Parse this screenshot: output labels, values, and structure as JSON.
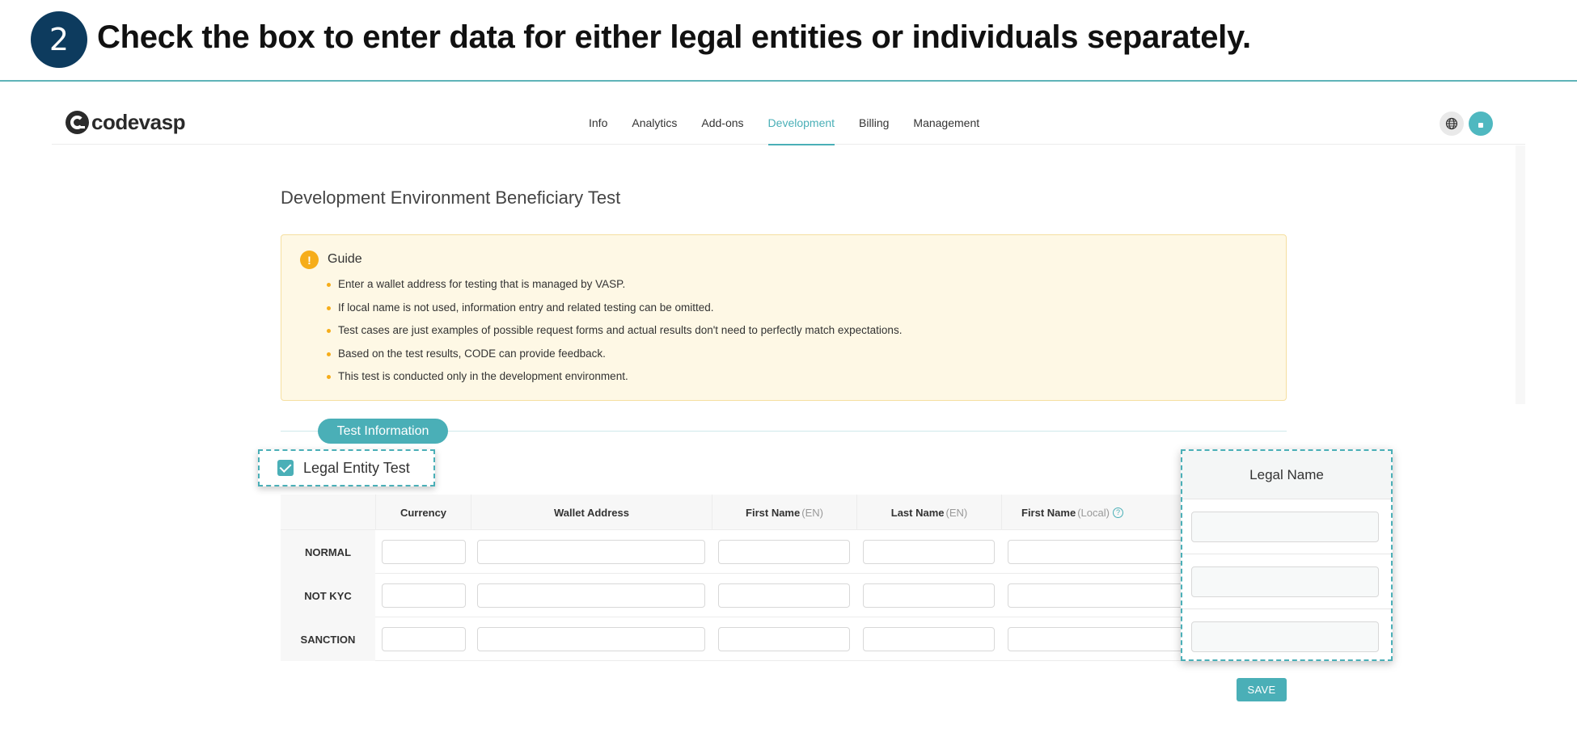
{
  "instruction": {
    "step": "2",
    "text": "Check the box to enter data for either legal entities or individuals separately."
  },
  "header": {
    "logo_text": "codevasp",
    "nav": [
      {
        "label": "Info",
        "active": false
      },
      {
        "label": "Analytics",
        "active": false
      },
      {
        "label": "Add-ons",
        "active": false
      },
      {
        "label": "Development",
        "active": true
      },
      {
        "label": "Billing",
        "active": false
      },
      {
        "label": "Management",
        "active": false
      }
    ],
    "icons": [
      "globe-icon",
      "avatar"
    ]
  },
  "page": {
    "title": "Development Environment Beneficiary Test"
  },
  "guide": {
    "title": "Guide",
    "icon": "!",
    "items": [
      "Enter a wallet address for testing that is managed by VASP.",
      "If local name is not used, information entry and related testing can be omitted.",
      "Test cases are just examples of possible request forms and actual results don't need to perfectly match expectations.",
      "Based on the test results, CODE can provide feedback.",
      "This test is conducted only in the development environment."
    ]
  },
  "section": {
    "label": "Test Information"
  },
  "checkbox": {
    "label": "Legal Entity Test",
    "checked": true
  },
  "table": {
    "columns": [
      {
        "label": "Currency",
        "sub": ""
      },
      {
        "label": "Wallet Address",
        "sub": ""
      },
      {
        "label": "First Name",
        "sub": "(EN)"
      },
      {
        "label": "Last Name",
        "sub": "(EN)"
      },
      {
        "label": "First Name",
        "sub": "(Local)"
      }
    ],
    "rows": [
      "NORMAL",
      "NOT KYC",
      "SANCTION"
    ]
  },
  "legal_name": {
    "header": "Legal Name"
  },
  "save_label": "SAVE",
  "colors": {
    "accent": "#4aafb7",
    "step_badge": "#0d3b5e",
    "guide_bg": "#fef8e5",
    "guide_icon": "#f6ad1a"
  }
}
